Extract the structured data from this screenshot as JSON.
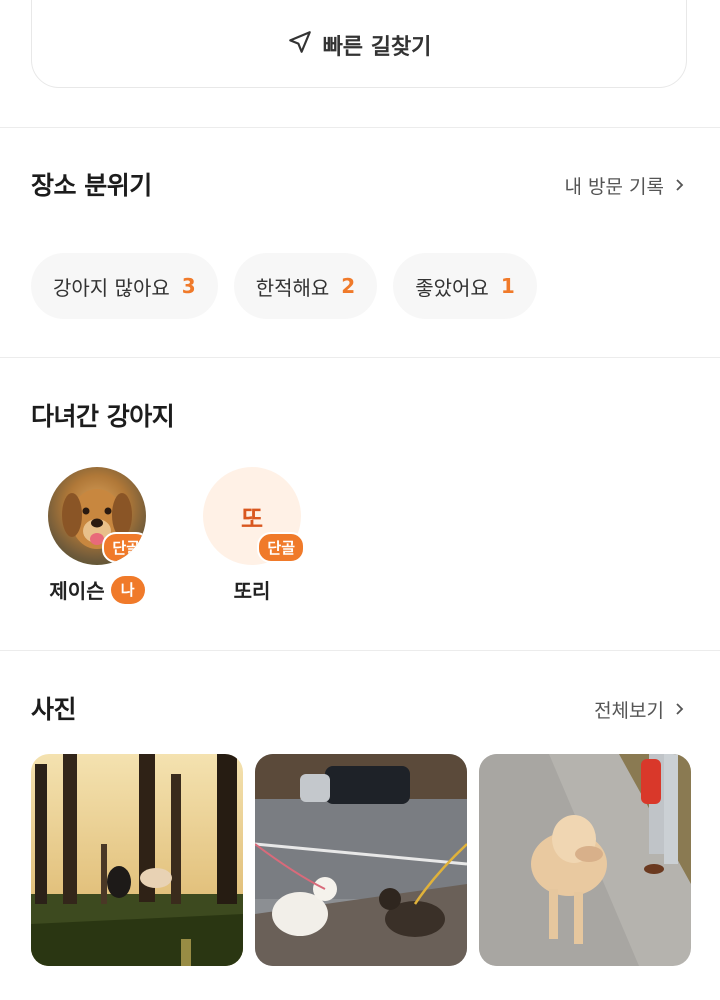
{
  "top_card": {
    "route_label": "빠른 길찾기"
  },
  "atmosphere": {
    "title": "장소 분위기",
    "link": "내 방문 기록",
    "chips": [
      {
        "label": "강아지 많아요",
        "count": "3"
      },
      {
        "label": "한적해요",
        "count": "2"
      },
      {
        "label": "좋았어요",
        "count": "1"
      }
    ]
  },
  "visited_dogs": {
    "title": "다녀간 강아지",
    "dogs": [
      {
        "name": "제이슨",
        "badge": "단골",
        "me": "나",
        "avatar": "photo"
      },
      {
        "name": "또리",
        "badge": "단골",
        "initial": "또",
        "avatar": "letter"
      }
    ]
  },
  "photos": {
    "title": "사진",
    "link": "전체보기",
    "items": [
      {
        "icon": "park-dog-photo"
      },
      {
        "icon": "street-dogs-photo"
      },
      {
        "icon": "golden-retriever-walk-photo"
      }
    ]
  },
  "colors": {
    "accent": "#f07a2a",
    "chip_bg": "#f7f7f7",
    "avatar_bg": "#fff1e6"
  }
}
